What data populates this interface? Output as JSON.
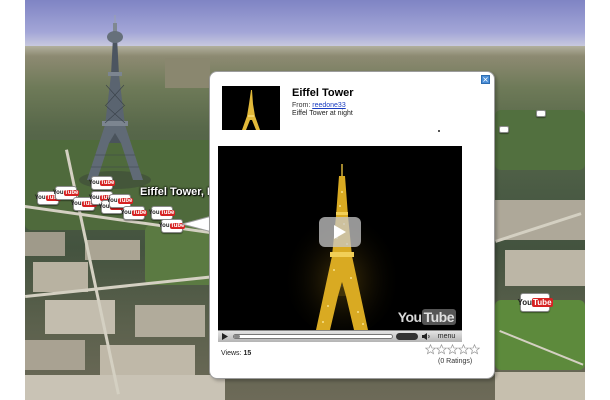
{
  "map": {
    "place_label": "Eiffel Tower, Paris,",
    "marker_icon": "youtube-marker-icon"
  },
  "balloon": {
    "close_symbol": "×",
    "title": "Eiffel Tower",
    "from_label": "From:",
    "uploader": "reedone33",
    "description": "Eiffel Tower at night",
    "player": {
      "watermark_you": "You",
      "watermark_tube": "Tube",
      "menu_label": "menu",
      "progress": 0.04
    },
    "views_label": "Views:",
    "views_count": "15",
    "rating_stars": 0,
    "rating_max": 5,
    "ratings_text": "(0 Ratings)"
  },
  "colors": {
    "link": "#1a3dc2",
    "youtube_red": "#d62222",
    "close_button": "#4a8ed8"
  }
}
